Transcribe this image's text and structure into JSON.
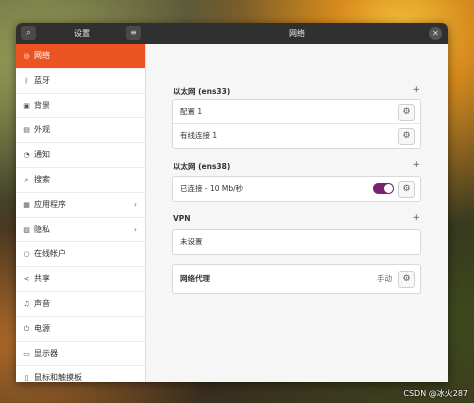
{
  "window": {
    "sidebar_title": "设置",
    "panel_title": "网络"
  },
  "sidebar": {
    "items": [
      {
        "label": "网络",
        "icon": "network-icon"
      },
      {
        "label": "蓝牙",
        "icon": "bluetooth-icon"
      },
      {
        "label": "背景",
        "icon": "background-icon"
      },
      {
        "label": "外观",
        "icon": "appearance-icon"
      },
      {
        "label": "通知",
        "icon": "notification-icon"
      },
      {
        "label": "搜索",
        "icon": "search-icon"
      },
      {
        "label": "应用程序",
        "icon": "apps-icon"
      },
      {
        "label": "隐私",
        "icon": "privacy-icon"
      },
      {
        "label": "在线帐户",
        "icon": "online-accounts-icon"
      },
      {
        "label": "共享",
        "icon": "sharing-icon"
      },
      {
        "label": "声音",
        "icon": "sound-icon"
      },
      {
        "label": "电源",
        "icon": "power-icon"
      },
      {
        "label": "显示器",
        "icon": "display-icon"
      },
      {
        "label": "鼠标和触摸板",
        "icon": "mouse-icon"
      }
    ]
  },
  "ethernet33": {
    "title": "以太网 (ens33)",
    "rows": [
      "配置 1",
      "有线连接 1"
    ]
  },
  "ethernet38": {
    "title": "以太网 (ens38)",
    "status": "已连接 - 10 Mb/秒",
    "toggle_on": true
  },
  "vpn": {
    "title": "VPN",
    "status": "未设置"
  },
  "proxy": {
    "label": "网络代理",
    "status": "手动"
  },
  "watermark": "CSDN @冰火287",
  "colors": {
    "accent": "#e95420",
    "toggle": "#77216f",
    "titlebar": "#303030"
  }
}
